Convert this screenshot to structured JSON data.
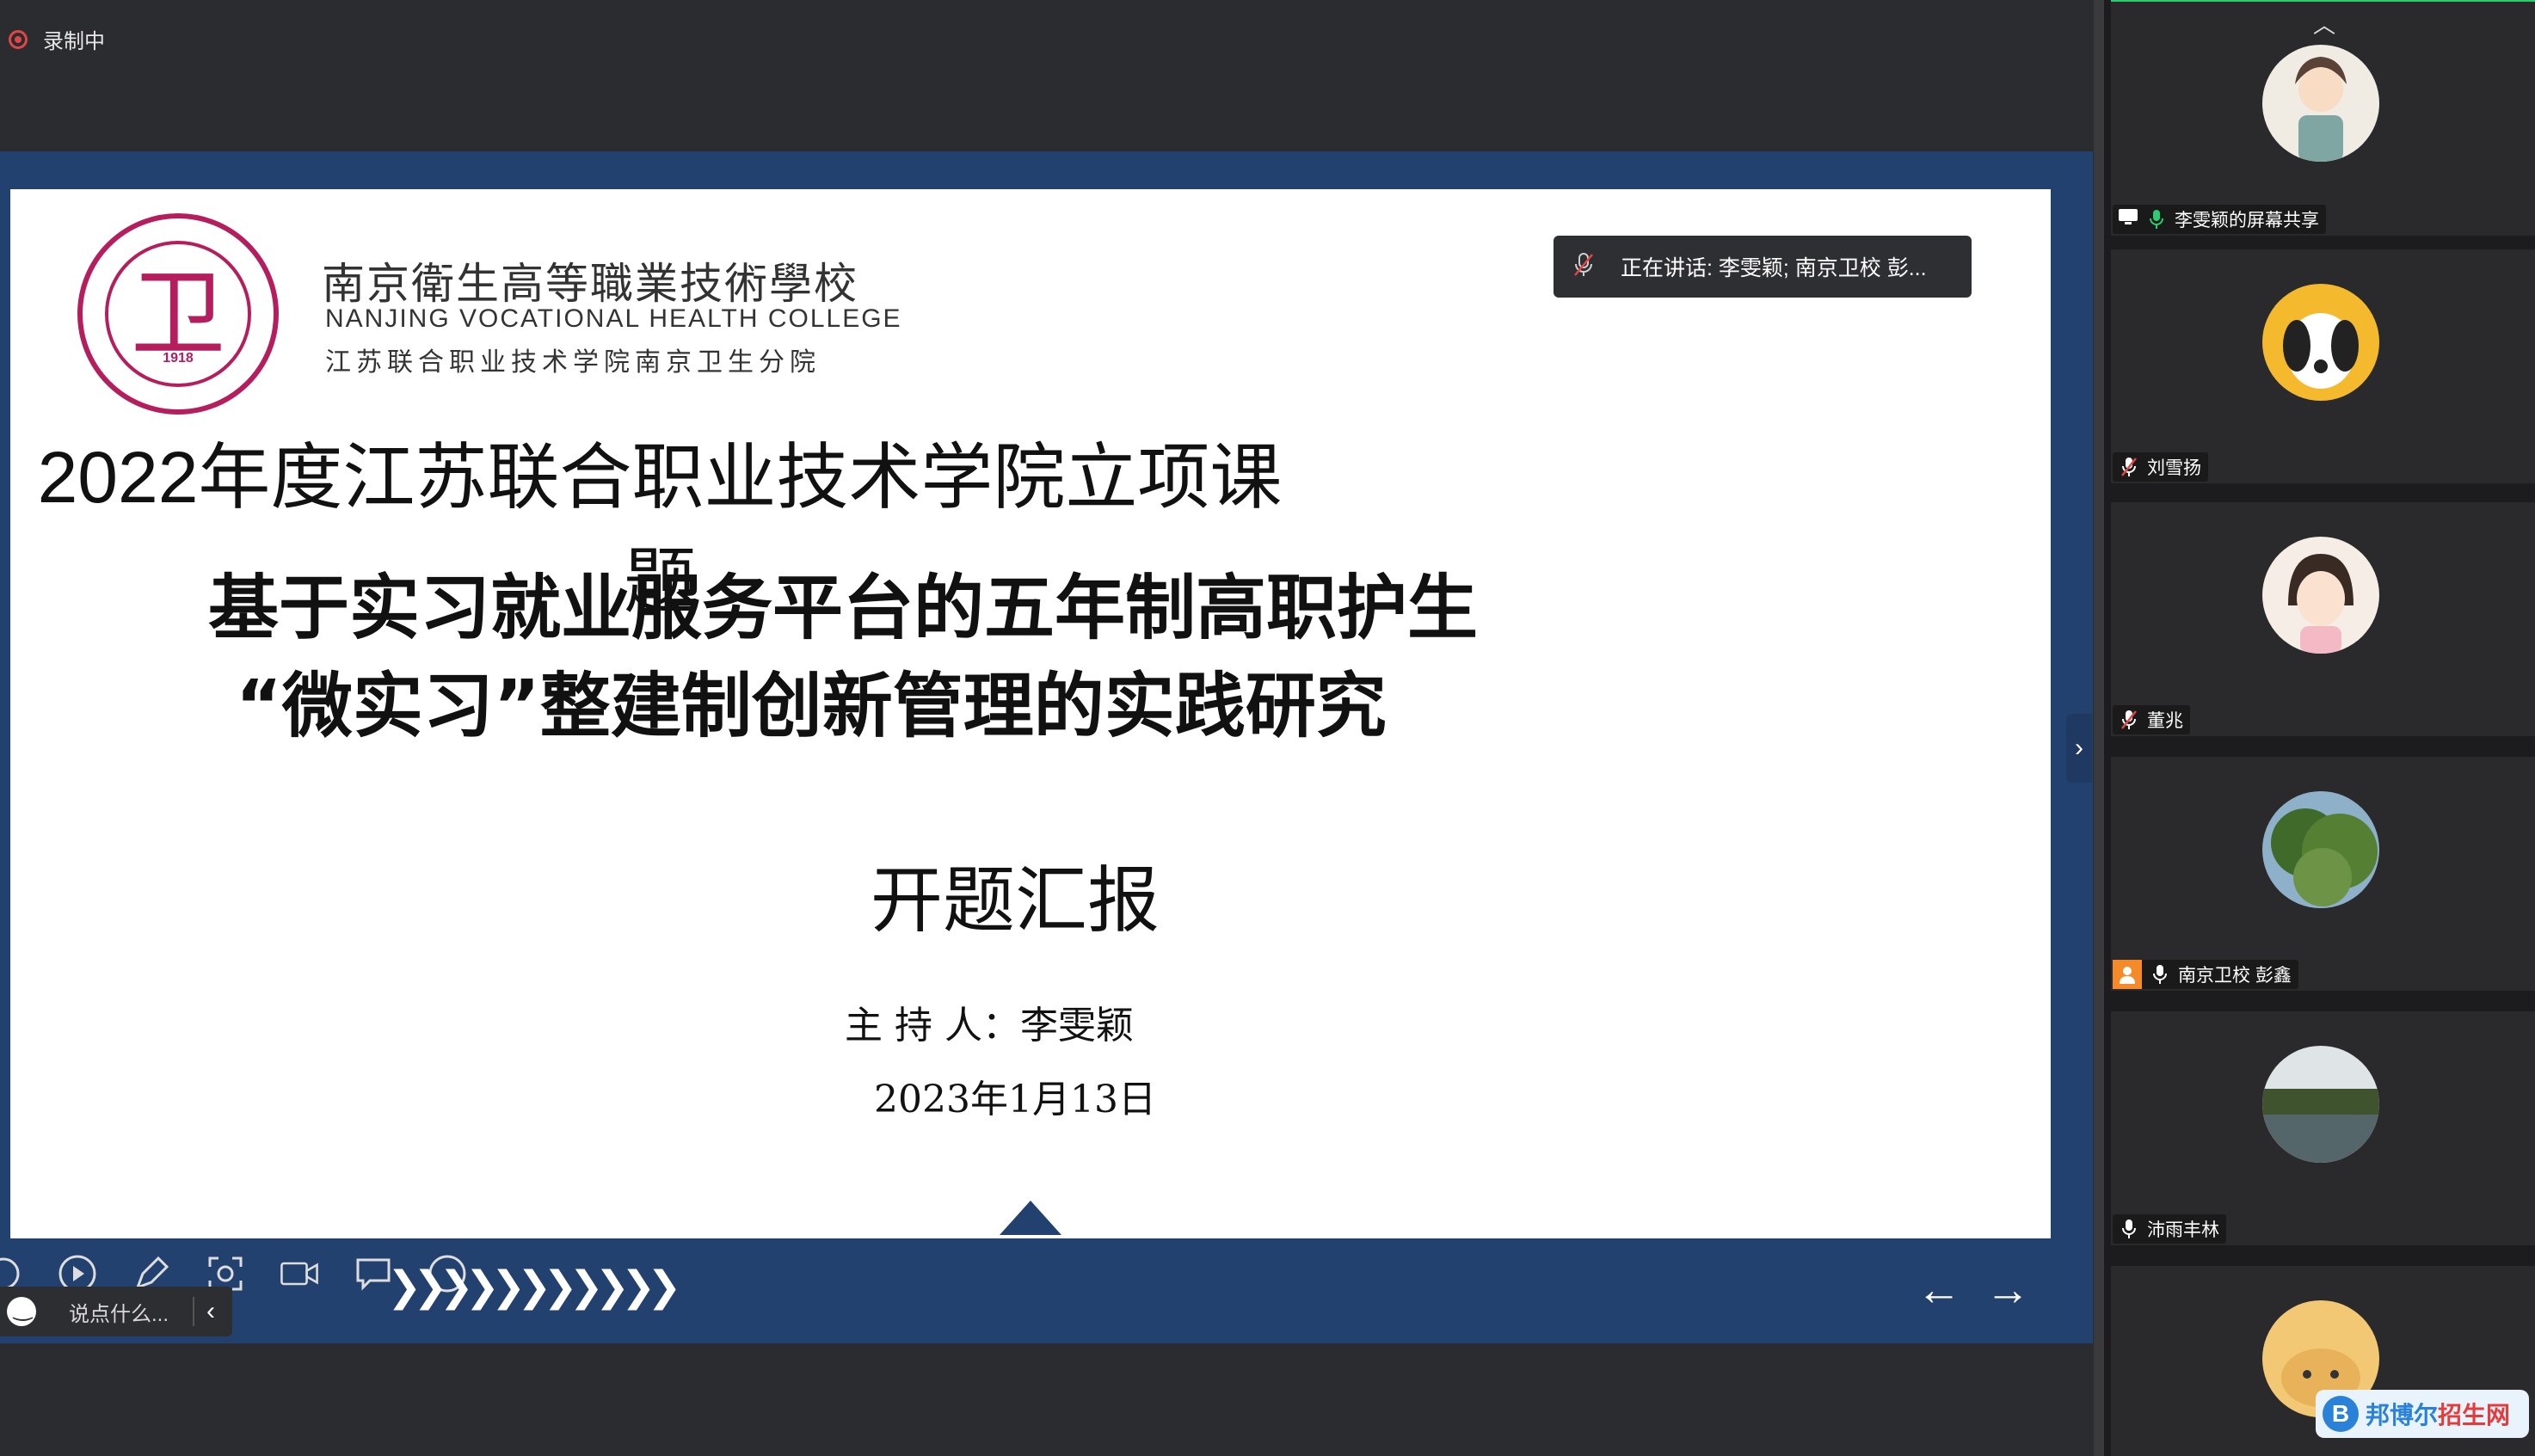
{
  "recording": {
    "label": "录制中"
  },
  "slide": {
    "school_name_cn": "南京衛生高等職業技術學校",
    "school_name_en": "NANJING VOCATIONAL HEALTH COLLEGE",
    "school_sub": "江苏联合职业技术学院南京卫生分院",
    "logo_glyph": "卫",
    "logo_year": "1918",
    "title_year": "2022年度江苏联合职业技术学院立项课题",
    "title_line1": "基于实习就业服务平台的五年制高职护生",
    "title_line2": "“微实习”整建制创新管理的实践研究",
    "report": "开题汇报",
    "host": "主  持   人：李雯颖",
    "date": "2023年1月13日"
  },
  "speaking": {
    "text": "正在讲话: 李雯颖; 南京卫校 彭..."
  },
  "chat": {
    "placeholder": "说点什么..."
  },
  "participants": [
    {
      "name": "李雯颖的屏幕共享",
      "mic": "mic-on",
      "avatar": "cartoon-girl"
    },
    {
      "name": "刘雪扬",
      "mic": "mic-muted",
      "avatar": "snoopy"
    },
    {
      "name": "董兆",
      "mic": "mic-muted",
      "avatar": "girl"
    },
    {
      "name": "南京卫校  彭鑫",
      "mic": "mic-on",
      "avatar": "tree"
    },
    {
      "name": "沛雨丰林",
      "mic": "mic-on",
      "avatar": "lake"
    },
    {
      "name": "",
      "mic": "",
      "avatar": "bear"
    }
  ],
  "watermark": {
    "logo": "B",
    "text_a": "邦博尔",
    "text_b": "招生网"
  },
  "colors": {
    "accent": "#23416e",
    "logo": "#b51d5d",
    "active": "#2ecc71"
  }
}
